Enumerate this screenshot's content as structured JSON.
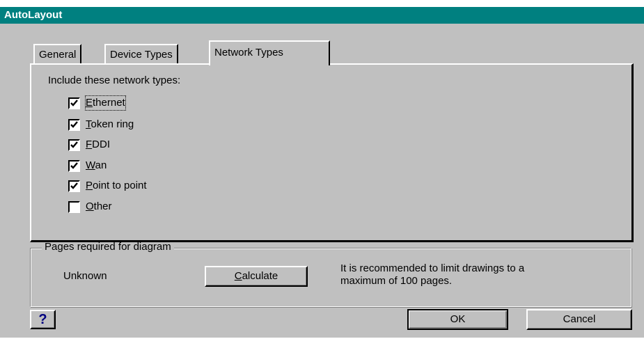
{
  "window": {
    "title": "AutoLayout"
  },
  "tabs": [
    {
      "label": "General",
      "active": false
    },
    {
      "label": "Device Types",
      "active": false
    },
    {
      "label": "Network Types",
      "active": true
    }
  ],
  "network_types": {
    "heading": "Include these network types:",
    "items": [
      {
        "mnemonic": "E",
        "rest": "thernet",
        "checked": true,
        "focused": true
      },
      {
        "mnemonic": "T",
        "rest": "oken ring",
        "checked": true,
        "focused": false
      },
      {
        "mnemonic": "F",
        "rest": "DDI",
        "checked": true,
        "focused": false
      },
      {
        "mnemonic": "W",
        "rest": "an",
        "checked": true,
        "focused": false
      },
      {
        "mnemonic": "P",
        "rest": "oint to point",
        "checked": true,
        "focused": false
      },
      {
        "mnemonic": "O",
        "rest": "ther",
        "checked": false,
        "focused": false
      }
    ]
  },
  "pages_group": {
    "legend": "Pages required for diagram",
    "status": "Unknown",
    "calculate_mnemonic": "C",
    "calculate_rest": "alculate",
    "recommendation_line1": "It is recommended to limit drawings to a",
    "recommendation_line2": "maximum of 100 pages."
  },
  "footer": {
    "help_glyph": "?",
    "ok_label": "OK",
    "cancel_label": "Cancel"
  },
  "colors": {
    "titlebar": "#008080",
    "face": "#c0c0c0",
    "help_glyph": "#000080"
  },
  "icons": {
    "checkmark": "checkmark-icon",
    "help": "help-icon"
  }
}
